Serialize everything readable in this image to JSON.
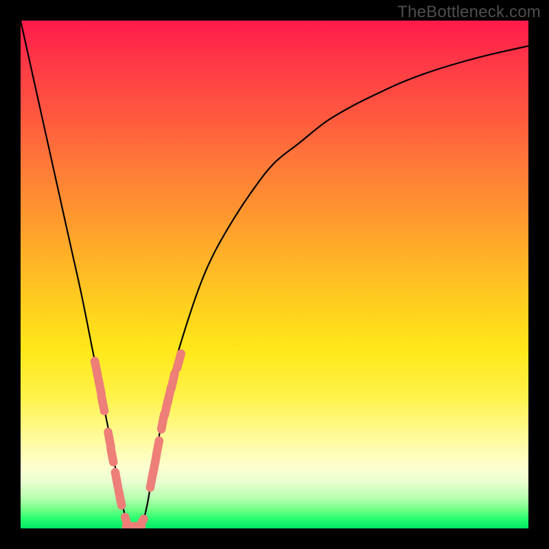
{
  "watermark": "TheBottleneck.com",
  "colors": {
    "frame": "#000000",
    "curve_stroke": "#000000",
    "marker_fill": "#ed7e78",
    "marker_stroke": "#ed7e78"
  },
  "chart_data": {
    "type": "line",
    "title": "",
    "xlabel": "",
    "ylabel": "",
    "xlim": [
      0,
      100
    ],
    "ylim": [
      0,
      100
    ],
    "note": "Axes are unlabeled in the source image; x/y units are normalized 0–100. y represents a bottleneck-style mismatch percentage (0 at the minimum, rising toward 100).",
    "series": [
      {
        "name": "curve",
        "x": [
          0,
          2,
          4,
          6,
          8,
          10,
          12,
          14,
          15,
          16,
          17,
          18,
          19,
          20,
          21,
          22,
          23,
          24,
          25,
          26,
          28,
          30,
          32,
          35,
          38,
          42,
          46,
          50,
          55,
          60,
          65,
          70,
          75,
          80,
          85,
          90,
          95,
          100
        ],
        "y": [
          100,
          91,
          82,
          73,
          64,
          55,
          46,
          36,
          31,
          26,
          21,
          16,
          10,
          5,
          1,
          0,
          0,
          1,
          5,
          11,
          22,
          31,
          38,
          47,
          54,
          61,
          67,
          72,
          76,
          80,
          83,
          85.5,
          87.8,
          89.7,
          91.3,
          92.7,
          93.9,
          95
        ]
      }
    ],
    "markers": {
      "name": "highlighted-points",
      "note": "Salmon rounded markers clustered near the curve minimum and its approaches.",
      "points": [
        {
          "x": 14.9,
          "y": 31.5
        },
        {
          "x": 15.6,
          "y": 28.0
        },
        {
          "x": 16.2,
          "y": 24.6
        },
        {
          "x": 17.5,
          "y": 17.5
        },
        {
          "x": 18.0,
          "y": 14.5
        },
        {
          "x": 18.9,
          "y": 9.6
        },
        {
          "x": 19.6,
          "y": 6.0
        },
        {
          "x": 21.0,
          "y": 0.8
        },
        {
          "x": 22.3,
          "y": 0.4
        },
        {
          "x": 23.5,
          "y": 0.6
        },
        {
          "x": 25.8,
          "y": 9.5
        },
        {
          "x": 26.4,
          "y": 12.5
        },
        {
          "x": 27.0,
          "y": 15.8
        },
        {
          "x": 28.0,
          "y": 21.0
        },
        {
          "x": 28.7,
          "y": 23.8
        },
        {
          "x": 29.3,
          "y": 26.3
        },
        {
          "x": 30.0,
          "y": 29.0
        },
        {
          "x": 31.2,
          "y": 33.0
        }
      ]
    }
  }
}
